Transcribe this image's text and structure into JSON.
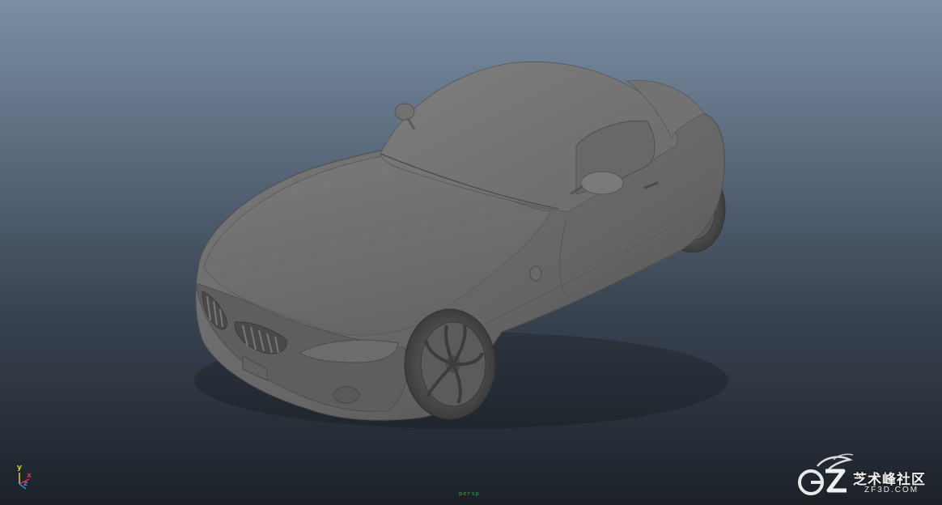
{
  "viewport": {
    "name": "3D perspective viewport",
    "camera_label": "persp",
    "background_top": "#7b8ea4",
    "background_bottom": "#1c2128",
    "model_color": "#6e6e6e"
  },
  "axis_gizmo": {
    "y_label": "y",
    "x_label": "x",
    "z_label": "z",
    "colors": {
      "y": "#cfd63a",
      "x": "#d03a3a",
      "z": "#4a7cdd"
    }
  },
  "watermark": {
    "icon": "zf3d-logo-icon",
    "title": "芝术峰社区",
    "domain": "ZF3D.COM"
  }
}
